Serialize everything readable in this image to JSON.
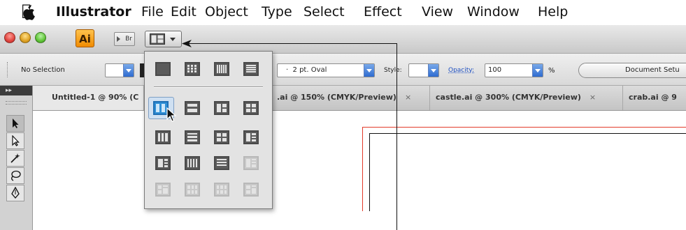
{
  "menubar": {
    "apple_icon": "apple-icon",
    "app_name": "Illustrator",
    "items": [
      "File",
      "Edit",
      "Object",
      "Type",
      "Select",
      "Effect",
      "View",
      "Window",
      "Help"
    ]
  },
  "appbar": {
    "app_logo": "Ai",
    "bridge_label": "Br",
    "traffic_colors": [
      "#e0443e",
      "#dea123",
      "#5fc436"
    ]
  },
  "control_bar": {
    "selection_label": "No Selection",
    "brush_value": "2 pt. Oval",
    "style_label": "Style:",
    "opacity_label": "Opacity:",
    "opacity_value": "100",
    "percent_sign": "%",
    "document_setup_label": "Document Setu"
  },
  "tabs": [
    {
      "label": "Untitled-1 @ 90% (C"
    },
    {
      "label": ".ai @ 150% (CMYK/Preview)",
      "close": "×"
    },
    {
      "label": "castle.ai @ 300% (CMYK/Preview)",
      "close": "×"
    },
    {
      "label": "crab.ai @ 9"
    }
  ],
  "arrange_popup": {
    "icons": [
      "consolidate-all-icon",
      "tile-all-in-grid-icon",
      "tile-all-vertically-icon",
      "tile-all-horizontally-icon",
      "2-up-vertical-icon",
      "2-up-horizontal-icon",
      "2-up-grid-icon",
      "3-up-grid-icon",
      "3-up-vertical-icon",
      "3-up-horizontal-icon",
      "4-up-grid-icon",
      "4-up-mixed-icon",
      "5-up-grid-icon",
      "4-up-vertical-icon",
      "4-up-horizontal-icon",
      "5-up-mixed-icon",
      "6-up-grid-icon",
      "6-up-mixed-icon",
      "6-up-vertical-icon",
      "6-up-horizontal-icon"
    ],
    "selected": "2-up-vertical-icon"
  },
  "colors": {
    "artboard_red": "#e23b2a",
    "selection_blue": "#2f8fd6"
  }
}
